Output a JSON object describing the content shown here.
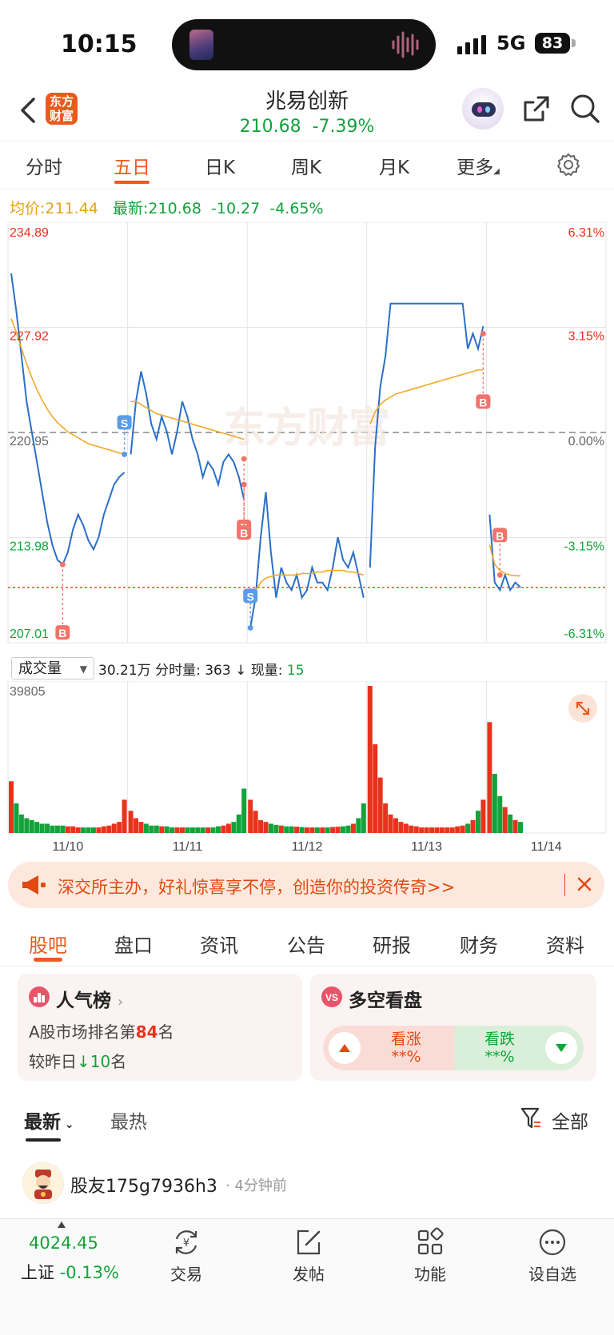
{
  "status_bar": {
    "time": "10:15",
    "network": "5G",
    "battery": "83"
  },
  "header": {
    "logo_line1": "东方",
    "logo_line2": "财富",
    "stock_name": "兆易创新",
    "price": "210.68",
    "change_pct": "-7.39%"
  },
  "period_tabs": [
    "分时",
    "五日",
    "日K",
    "周K",
    "月K",
    "更多"
  ],
  "active_period": "五日",
  "avg_row": {
    "avg_label": "均价:",
    "avg_value": "211.44",
    "latest_label": "最新:",
    "latest_value": "210.68",
    "change": "-10.27",
    "change_pct": "-4.65%"
  },
  "colors": {
    "accent": "#ea5a1e",
    "up": "#e8331c",
    "down": "#12a33a",
    "price_line": "#2b6fc9",
    "avg_line": "#f0a92a"
  },
  "chart_data": {
    "type": "line",
    "prev_close": 220.95,
    "ylim": [
      207.01,
      234.89
    ],
    "y_ticks_left": [
      "234.89",
      "227.92",
      "220.95",
      "213.98",
      "207.01"
    ],
    "y_ticks_right": [
      "6.31%",
      "3.15%",
      "0.00%",
      "-3.15%",
      "-6.31%"
    ],
    "x_labels": [
      "11/10",
      "11/11",
      "11/12",
      "11/13",
      "11/14"
    ],
    "latest_price": 210.68,
    "days": [
      {
        "date": "11/10",
        "price": [
          231.5,
          229,
          226,
          223,
          221,
          219,
          217,
          215,
          213.5,
          212.5,
          212.2,
          213,
          214.5,
          215.5,
          214.8,
          213.8,
          213.2,
          214,
          215.5,
          216.5,
          217.5,
          218,
          218.3
        ],
        "avg": [
          228.5,
          227.6,
          226.5,
          225.5,
          224.6,
          223.8,
          223.1,
          222.5,
          222,
          221.6,
          221.3,
          221,
          220.8,
          220.6,
          220.4,
          220.2,
          220.1,
          220,
          219.9,
          219.8,
          219.7,
          219.6,
          219.5
        ]
      },
      {
        "date": "11/11",
        "price": [
          219.5,
          223,
          225,
          223.5,
          221.5,
          220.5,
          222,
          221,
          219.5,
          221,
          223,
          222,
          220.5,
          219.5,
          218,
          219,
          218.5,
          217.5,
          219,
          219.5,
          219,
          218,
          216.5
        ],
        "avg": [
          223,
          223,
          222.8,
          222.6,
          222.4,
          222.2,
          222.1,
          222,
          221.9,
          221.8,
          221.7,
          221.6,
          221.5,
          221.4,
          221.3,
          221.2,
          221.1,
          221,
          220.9,
          220.8,
          220.7,
          220.6,
          220.5
        ]
      },
      {
        "date": "11/12",
        "price": [
          208,
          210,
          214,
          217,
          213,
          210,
          212,
          211,
          210.5,
          211.5,
          210,
          210.5,
          212,
          211,
          211,
          210.5,
          212,
          214,
          212.5,
          212,
          213,
          211.5,
          210
        ],
        "avg": [
          209.5,
          210.5,
          211,
          211.3,
          211.4,
          211.5,
          211.5,
          211.5,
          211.5,
          211.5,
          211.6,
          211.6,
          211.6,
          211.7,
          211.7,
          211.8,
          211.8,
          211.8,
          211.8,
          211.7,
          211.7,
          211.6,
          211.5
        ]
      },
      {
        "date": "11/13",
        "price": [
          212,
          220,
          224,
          226,
          229.5,
          229.5,
          229.5,
          229.5,
          229.5,
          229.5,
          229.5,
          229.5,
          229.5,
          229.5,
          229.5,
          229.5,
          229.5,
          229.5,
          229.5,
          226.5,
          227.5,
          226.5,
          228
        ],
        "avg": [
          221.5,
          222.3,
          222.8,
          223.1,
          223.3,
          223.5,
          223.6,
          223.7,
          223.8,
          223.9,
          224,
          224.1,
          224.2,
          224.3,
          224.4,
          224.5,
          224.6,
          224.7,
          224.8,
          224.9,
          225,
          225.1,
          225.1
        ]
      },
      {
        "date": "11/14",
        "price": [
          215.5,
          211,
          210.5,
          211.5,
          210.5,
          211,
          210.68
        ],
        "avg": [
          213.5,
          212.2,
          211.8,
          211.6,
          211.5,
          211.45,
          211.44
        ]
      }
    ],
    "markers": [
      {
        "label": "B",
        "day": 0,
        "index": 10,
        "price": 212.2,
        "side": "below"
      },
      {
        "label": "S",
        "day": 0,
        "index": 22,
        "price": 219.5,
        "side": "above"
      },
      {
        "label": "B",
        "day": 1,
        "index": 22,
        "price": 219.2,
        "side": "below"
      },
      {
        "label": "B",
        "day": 1,
        "index": 22,
        "price": 217.5,
        "side": "below2"
      },
      {
        "label": "S",
        "day": 2,
        "index": 0,
        "price": 208,
        "side": "above"
      },
      {
        "label": "B",
        "day": 3,
        "index": 22,
        "price": 227.5,
        "side": "below"
      },
      {
        "label": "B",
        "day": 4,
        "index": 2,
        "price": 211.5,
        "side": "above"
      }
    ],
    "volume": {
      "ymax": 39805,
      "ylabel": "39805",
      "days": [
        [
          14000,
          8000,
          5000,
          4000,
          3500,
          3000,
          2500,
          2500,
          2000,
          2000,
          2000,
          1800,
          1800,
          1500,
          1500,
          1500,
          1500,
          1500,
          1800,
          2000,
          2500,
          3000,
          9000
        ],
        [
          6000,
          4000,
          3000,
          2500,
          2000,
          2000,
          1800,
          1800,
          1500,
          1500,
          1500,
          1500,
          1500,
          1500,
          1500,
          1500,
          1500,
          1800,
          2000,
          2500,
          3000,
          5000,
          12000
        ],
        [
          9000,
          6000,
          3500,
          3000,
          2500,
          2200,
          2000,
          1800,
          1800,
          1700,
          1600,
          1500,
          1500,
          1500,
          1500,
          1500,
          1600,
          1700,
          1800,
          2000,
          2500,
          4000,
          8000
        ],
        [
          39805,
          24000,
          15000,
          8000,
          5000,
          4000,
          3000,
          2500,
          2000,
          1800,
          1500,
          1500,
          1500,
          1500,
          1500,
          1500,
          1500,
          1800,
          2000,
          2500,
          3500,
          6000,
          9000
        ],
        [
          30000,
          16000,
          10000,
          7000,
          5000,
          3500,
          3000
        ]
      ]
    }
  },
  "volume_bar": {
    "select_label": "成交量",
    "total": "30.21万",
    "ts_label": "分时量:",
    "ts_value": "363",
    "arrow": "↓",
    "now_label": "现量:",
    "now_value": "15"
  },
  "banner": {
    "text": "深交所主办，好礼惊喜享不停，创造你的投资传奇>>"
  },
  "section_tabs": [
    "股吧",
    "盘口",
    "资讯",
    "公告",
    "研报",
    "财务",
    "资料"
  ],
  "active_section": "股吧",
  "popularity_card": {
    "title": "人气榜",
    "rank_prefix": "A股市场排名第",
    "rank": "84",
    "rank_suffix": "名",
    "change_prefix": "较昨日",
    "change": "10",
    "change_suffix": "名"
  },
  "sentiment_card": {
    "title": "多空看盘",
    "bull_label": "看涨",
    "bull_value": "**%",
    "bear_label": "看跌",
    "bear_value": "**%"
  },
  "feed_tabs": {
    "latest": "最新",
    "hot": "最热",
    "filter": "全部"
  },
  "post": {
    "user": "股友175g7936h3",
    "time": "4分钟前"
  },
  "bottom_bar": {
    "index_value": "4024.45",
    "index_name": "上证",
    "index_change": "-0.13%",
    "nav": [
      {
        "label": "交易",
        "icon": "trade-icon"
      },
      {
        "label": "发帖",
        "icon": "post-icon"
      },
      {
        "label": "功能",
        "icon": "apps-icon"
      },
      {
        "label": "设自选",
        "icon": "more-icon"
      }
    ]
  }
}
